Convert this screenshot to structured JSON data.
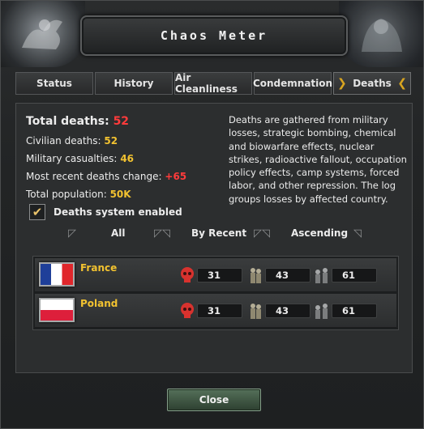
{
  "window": {
    "title": "Chaos Meter",
    "title_display": "Chaos Meter"
  },
  "tabs": [
    {
      "label": "Status"
    },
    {
      "label": "History"
    },
    {
      "label": "Air Cleanliness"
    },
    {
      "label": "Condemnation"
    },
    {
      "label": "Deaths",
      "active": true
    }
  ],
  "stats": {
    "total_deaths_label": "Total deaths:",
    "total_deaths_value": "52",
    "civilian_label": "Civilian deaths:",
    "civilian_value": "52",
    "military_label": "Military casualties:",
    "military_value": "46",
    "recent_label": "Most recent deaths change:",
    "recent_value": "+65",
    "population_label": "Total population:",
    "population_value": "50K",
    "checkbox_label": "Deaths system enabled",
    "checkbox_checked": true
  },
  "description": "Deaths are gathered from military losses, strategic bombing, chemical and biowarfare effects, nuclear strikes, radioactive fallout, occupation policy effects, camp systems, forced labor, and other repression. The log groups losses by affected country.",
  "sort": {
    "filter_label": "All",
    "order_by_label": "By Recent",
    "direction_label": "Ascending"
  },
  "countries": [
    {
      "name": "France",
      "deaths": "31",
      "military": "43",
      "civilians": "61"
    },
    {
      "name": "Poland",
      "deaths": "31",
      "military": "43",
      "civilians": "61"
    }
  ],
  "icons": {
    "skull": "skull-icon",
    "soldier": "soldiers-icon",
    "civilian": "civilians-icon",
    "checkmark": "checkmark-icon"
  },
  "colors": {
    "accent_yellow": "#f2c230",
    "alert_red": "#ff3b3b",
    "close_green": "#3f5a44"
  },
  "footer": {
    "close_label": "Close"
  }
}
